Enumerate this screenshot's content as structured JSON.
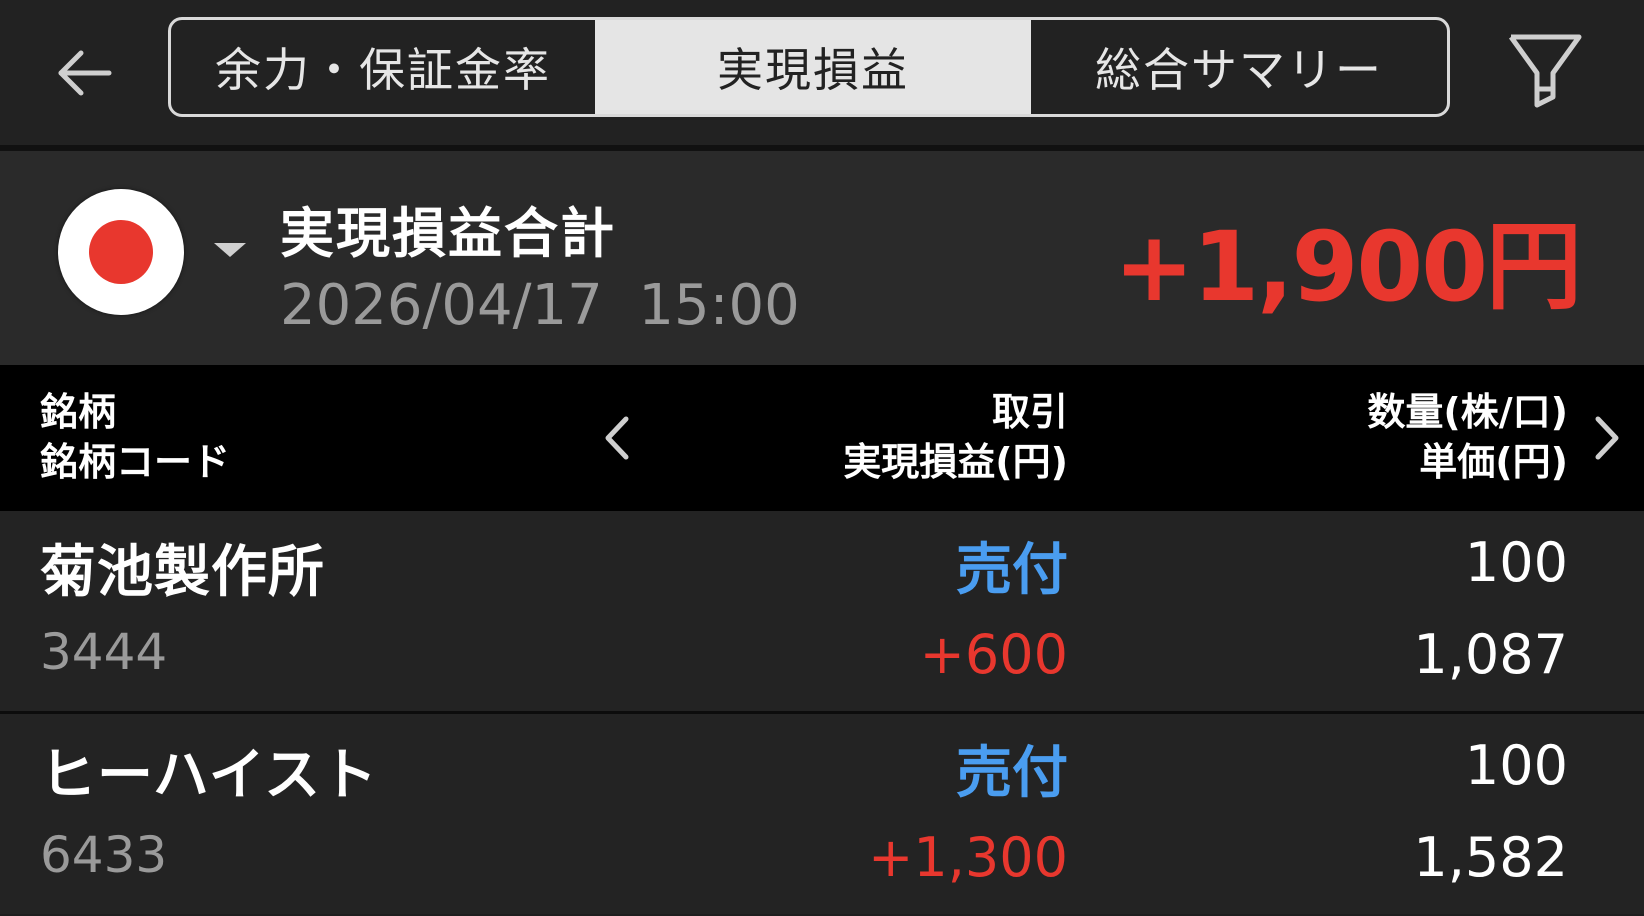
{
  "header": {
    "back_icon": "arrow-left-icon",
    "tabs": [
      {
        "label": "余力・保証金率",
        "active": false
      },
      {
        "label": "実現損益",
        "active": true
      },
      {
        "label": "総合サマリー",
        "active": false
      }
    ],
    "filter_icon": "filter-icon"
  },
  "summary": {
    "market_icon": "japan-flag-icon",
    "title": "実現損益合計",
    "datetime": "2026/04/17  15:00",
    "total": "+1,900円"
  },
  "table": {
    "col1_line1": "銘柄",
    "col1_line2": "銘柄コード",
    "col2_line1": "取引",
    "col2_line2": "実現損益(円)",
    "col3_line1": "数量(株/口)",
    "col3_line2": "単価(円)",
    "rows": [
      {
        "name": "菊池製作所",
        "code": "3444",
        "trade": "売付",
        "pl": "+600",
        "qty": "100",
        "price": "1,087"
      },
      {
        "name": "ヒーハイスト",
        "code": "6433",
        "trade": "売付",
        "pl": "+1,300",
        "qty": "100",
        "price": "1,582"
      }
    ]
  },
  "colors": {
    "accent_active_tab": "#e5e5e5",
    "profit": "#e8372e",
    "sell": "#4a9df0",
    "background": "#1e1e1e"
  }
}
